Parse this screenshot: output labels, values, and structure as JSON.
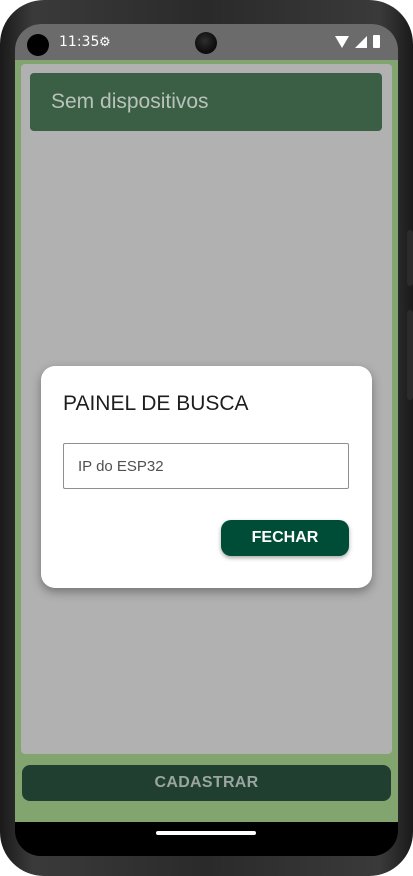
{
  "status_bar": {
    "time": "11:35",
    "icons": [
      "settings-icon",
      "wifi-icon",
      "signal-icon",
      "battery-icon"
    ]
  },
  "header": {
    "device_status": "Sem dispositivos"
  },
  "dialog": {
    "title": "PAINEL DE BUSCA",
    "ip_field_placeholder": "IP do ESP32",
    "close_label": "FECHAR"
  },
  "footer": {
    "register_label": "CADASTRAR"
  },
  "colors": {
    "app_background": "#82a46f",
    "header_background": "#3b5f44",
    "primary_button": "#004d37",
    "scrim": "#b1b1b2"
  }
}
